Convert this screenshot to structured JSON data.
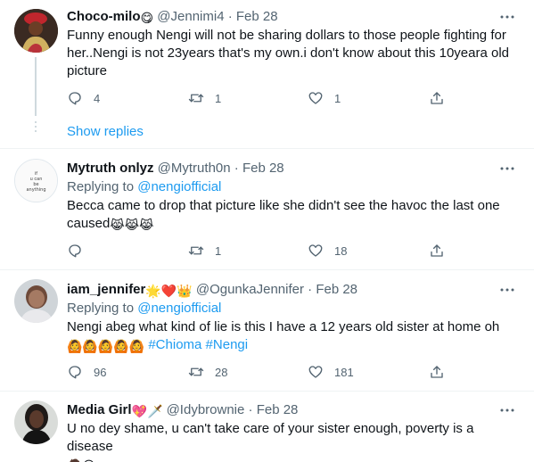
{
  "tweets": [
    {
      "name": "Choco-milo",
      "name_emoji": "😋",
      "handle": "@Jennimi4",
      "date": "Feb 28",
      "text": "Funny enough Nengi will not be sharing dollars to those people fighting for her..Nengi is not 23years that's my own.i don't know about this 10yeara old picture",
      "replies": "4",
      "retweets": "1",
      "likes": "1",
      "show_replies": "Show replies"
    },
    {
      "name": "Mytruth onlyz",
      "handle": "@Mytruth0n",
      "date": "Feb 28",
      "replying_label": "Replying to",
      "replying_handle": "@nengiofficial",
      "text": "Becca came to drop that picture like she didn't see the havoc the last one caused",
      "text_emoji": "😹😹😹",
      "replies": "",
      "retweets": "1",
      "likes": "18"
    },
    {
      "name": "iam_jennifer",
      "name_emoji": "🌟❤️👑",
      "handle": "@OgunkaJennifer",
      "date": "Feb 28",
      "replying_label": "Replying to",
      "replying_handle": "@nengiofficial",
      "text": "Nengi abeg what kind of lie is this I have a 12 years old sister at home oh",
      "text_emoji": "🙆🙆🙆🙆🙆",
      "hashtag1": "#Chioma",
      "hashtag2": "#Nengi",
      "replies": "96",
      "retweets": "28",
      "likes": "181"
    },
    {
      "name": "Media Girl",
      "name_emoji": "💖🗡️",
      "handle": "@Idybrownie",
      "date": "Feb 28",
      "text": "U no dey shame, u can't take care of your sister enough, poverty is a disease",
      "text_emoji": "🤦😜"
    }
  ],
  "colors": {
    "link": "#1d9bf0",
    "muted": "#536471",
    "divider": "#eff3f4"
  },
  "icons": [
    "more-icon",
    "reply-icon",
    "retweet-icon",
    "like-icon",
    "share-icon"
  ]
}
